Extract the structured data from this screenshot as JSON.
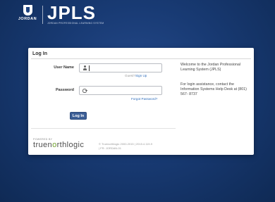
{
  "header": {
    "org_name": "JORDAN",
    "app_title": "JPLS",
    "app_subtitle": "JORDAN PROFESSIONAL LEARNING SYSTEM"
  },
  "login": {
    "title": "Log In",
    "username_label": "User Name",
    "username_value": "",
    "guest_text": "Guest?",
    "signup_link": "Sign Up",
    "password_label": "Password",
    "password_value": "",
    "forgot_link": "Forgot Password?",
    "submit_label": "Log In"
  },
  "footer": {
    "powered_by": "POWERED BY",
    "vendor_prefix": "truen",
    "vendor_accent": "o",
    "vendor_suffix": "rthlogic",
    "copyright_line1": "© Truenorthlogic 2000-2015 | 2015.4.115.9",
    "copyright_line2": "| FR: JORDAN-01"
  },
  "info": {
    "welcome_text": "Welcome to the Jordan Professional Learning System (JPLS)",
    "help_text": "For login assistance, contact the Information Systems Help Desk at (801) 567- 8737"
  },
  "colors": {
    "background": "#183a73",
    "button": "#3d5f96",
    "link": "#2f6dbb",
    "brand_accent": "#6f9f2b"
  }
}
